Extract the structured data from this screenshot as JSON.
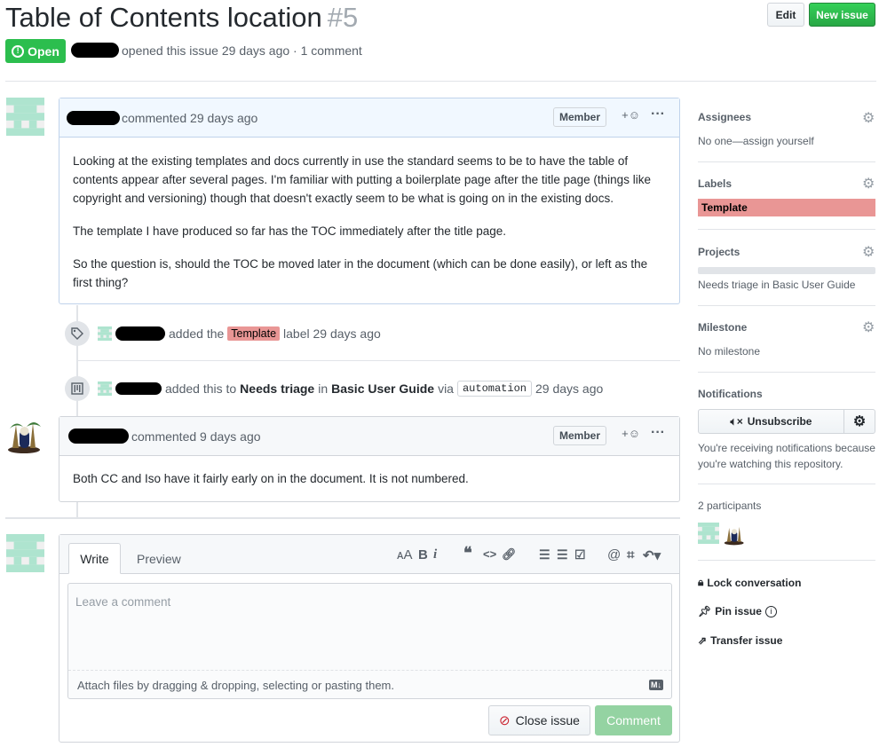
{
  "issue": {
    "title": "Table of Contents location",
    "number": "#5",
    "state": "Open",
    "meta": "opened this issue 29 days ago · 1 comment"
  },
  "header_buttons": {
    "edit": "Edit",
    "new_issue": "New issue"
  },
  "comments": [
    {
      "meta": "commented 29 days ago",
      "badge": "Member",
      "paragraphs": [
        "Looking at the existing templates and docs currently in use the standard seems to be to have the table of contents appear after several pages. I'm familiar with putting a boilerplate page after the title page (things like copyright and versioning) though that doesn't exactly seem to be what is going on in the existing docs.",
        "The template I have produced so far has the TOC immediately after the title page.",
        "So the question is, should the TOC be moved later in the document (which can be done easily), or left as the first thing?"
      ]
    },
    {
      "meta": "commented 9 days ago",
      "badge": "Member",
      "paragraphs": [
        "Both CC and Iso have it fairly early on in the document. It is not numbered."
      ]
    }
  ],
  "events": {
    "label_event": {
      "pre": "added the",
      "label": "Template",
      "post": "label 29 days ago"
    },
    "project_event": {
      "pre": "added this to",
      "column": "Needs triage",
      "in": "in",
      "project": "Basic User Guide",
      "via": "via",
      "bot": "automation",
      "time": "29 days ago"
    }
  },
  "composer": {
    "tab_write": "Write",
    "tab_preview": "Preview",
    "placeholder": "Leave a comment",
    "attach": "Attach files by dragging & dropping, selecting or pasting them.",
    "close_button": "Close issue",
    "comment_button": "Comment",
    "markdown_badge": "M↓"
  },
  "sidebar": {
    "assignees": {
      "heading": "Assignees",
      "value": "No one—assign yourself"
    },
    "labels": {
      "heading": "Labels",
      "label": "Template",
      "label_color": "#e99695"
    },
    "projects": {
      "heading": "Projects",
      "value": "Needs triage in Basic User Guide"
    },
    "milestone": {
      "heading": "Milestone",
      "value": "No milestone"
    },
    "notifications": {
      "heading": "Notifications",
      "button": "Unsubscribe",
      "value": "You're receiving notifications because you're watching this repository."
    },
    "participants": {
      "heading": "2 participants"
    },
    "actions": {
      "lock": "Lock conversation",
      "pin": "Pin issue",
      "transfer": "Transfer issue"
    }
  },
  "colors": {
    "open_green": "#2cbe4e",
    "accent_blue": "#0366d6",
    "comment_disabled": "#94d3a2"
  }
}
